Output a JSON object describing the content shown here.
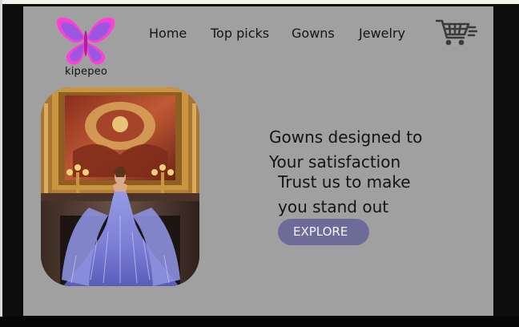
{
  "brand": {
    "name": "kipepeo",
    "logo_icon": "butterfly-icon",
    "logo_colors": [
      "#ff3fd6",
      "#9b57e0"
    ]
  },
  "nav": {
    "items": [
      {
        "label": "Home"
      },
      {
        "label": "Top picks"
      },
      {
        "label": "Gowns"
      },
      {
        "label": "Jewelry"
      }
    ],
    "cart_icon": "shopping-cart-icon"
  },
  "hero": {
    "headline_line1": "Gowns designed to",
    "headline_line2": "Your satisfaction",
    "subline_line1": "Trust us to make",
    "subline_line2": "you stand out",
    "cta_label": "EXPLORE",
    "image_subject": "model in lavender feathered gown in ornate golden room"
  },
  "colors": {
    "page_bg": "#a0a0a0",
    "cta_bg": "#6d6b97",
    "text": "#141414"
  }
}
